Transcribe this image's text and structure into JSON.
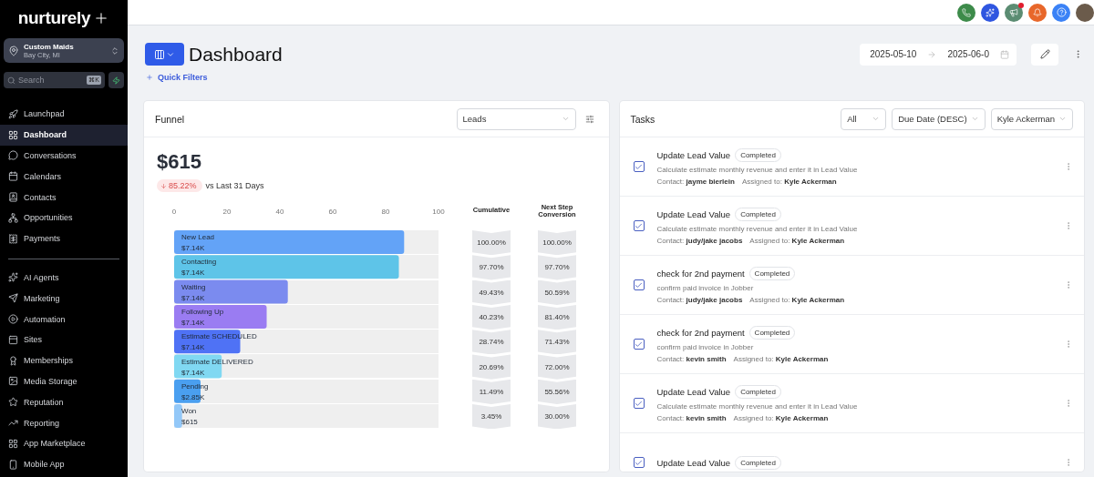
{
  "brand": {
    "logo": "nurturely"
  },
  "workspace": {
    "name": "Custom Maids",
    "location": "Bay City, MI"
  },
  "search": {
    "placeholder": "Search",
    "shortcut": "⌘K"
  },
  "nav_sections": [
    {
      "items": [
        {
          "label": "Launchpad",
          "selected": false
        },
        {
          "label": "Dashboard",
          "selected": true
        },
        {
          "label": "Conversations",
          "selected": false
        },
        {
          "label": "Calendars",
          "selected": false
        },
        {
          "label": "Contacts",
          "selected": false
        },
        {
          "label": "Opportunities",
          "selected": false
        },
        {
          "label": "Payments",
          "selected": false
        }
      ]
    },
    {
      "items": [
        {
          "label": "AI Agents",
          "selected": false
        },
        {
          "label": "Marketing",
          "selected": false
        },
        {
          "label": "Automation",
          "selected": false
        },
        {
          "label": "Sites",
          "selected": false
        },
        {
          "label": "Memberships",
          "selected": false
        },
        {
          "label": "Media Storage",
          "selected": false
        },
        {
          "label": "Reputation",
          "selected": false
        },
        {
          "label": "Reporting",
          "selected": false
        },
        {
          "label": "App Marketplace",
          "selected": false
        },
        {
          "label": "Mobile App",
          "selected": false
        }
      ]
    }
  ],
  "top_bar": {
    "announcement_unread": true
  },
  "page": {
    "title": "Dashboard",
    "quick_filters": "Quick Filters",
    "date_from": "2025-05-10",
    "date_to": "2025-06-0"
  },
  "funnel": {
    "title": "Funnel",
    "select": "Leads",
    "total": "$615",
    "change": "85.22%",
    "declined": true,
    "comparison": "vs Last 31 Days",
    "chart_data": {
      "type": "bar",
      "orientation": "horizontal",
      "categories": [
        "New Lead",
        "Contacting",
        "Waiting",
        "Following Up",
        "Estimate SCHEDULED",
        "Estimate DELIVERED",
        "Pending",
        "Won"
      ],
      "values": [
        87,
        85,
        43,
        35,
        25,
        18,
        10,
        3
      ],
      "xlim": [
        0,
        100
      ],
      "xticks": [
        0,
        20,
        40,
        60,
        80,
        100
      ]
    },
    "stage_amounts": [
      "$7.14K",
      "$7.14K",
      "$7.14K",
      "$7.14K",
      "$7.14K",
      "$7.14K",
      "$2.85K",
      "$615"
    ],
    "cumulative_header": "Cumulative",
    "cumulative": [
      "100.00%",
      "97.70%",
      "49.43%",
      "40.23%",
      "28.74%",
      "20.69%",
      "11.49%",
      "3.45%"
    ],
    "next_step_header": "Next Step Conversion",
    "next_step": [
      "100.00%",
      "97.70%",
      "50.59%",
      "81.40%",
      "71.43%",
      "72.00%",
      "55.56%",
      "30.00%"
    ]
  },
  "tasks": {
    "title": "Tasks",
    "filters": [
      "All",
      "Due Date (DESC)",
      "Kyle Ackerman"
    ],
    "items": [
      {
        "title": "Update Lead Value",
        "status": "Completed",
        "checked": true,
        "description": "Calculate estimate monthly revenue and enter it in Lead Value",
        "contact_label": "Contact:",
        "contact": "jayme bierlein",
        "assigned_label": "Assigned to:",
        "assignee": "Kyle Ackerman"
      },
      {
        "title": "Update Lead Value",
        "status": "Completed",
        "checked": true,
        "description": "Calculate estimate monthly revenue and enter it in Lead Value",
        "contact_label": "Contact:",
        "contact": "judy/jake jacobs",
        "assigned_label": "Assigned to:",
        "assignee": "Kyle Ackerman"
      },
      {
        "title": "check for 2nd payment",
        "status": "Completed",
        "checked": true,
        "description": "confirm paid invoice in Jobber",
        "contact_label": "Contact:",
        "contact": "judy/jake jacobs",
        "assigned_label": "Assigned to:",
        "assignee": "Kyle Ackerman"
      },
      {
        "title": "check for 2nd payment",
        "status": "Completed",
        "checked": true,
        "description": "confirm paid invoice in Jobber",
        "contact_label": "Contact:",
        "contact": "kevin smith",
        "assigned_label": "Assigned to:",
        "assignee": "Kyle Ackerman"
      },
      {
        "title": "Update Lead Value",
        "status": "Completed",
        "checked": true,
        "description": "Calculate estimate monthly revenue and enter it in Lead Value",
        "contact_label": "Contact:",
        "contact": "kevin smith",
        "assigned_label": "Assigned to:",
        "assignee": "Kyle Ackerman"
      },
      {
        "title": "Update Lead Value",
        "status": "Completed",
        "checked": true
      }
    ]
  }
}
